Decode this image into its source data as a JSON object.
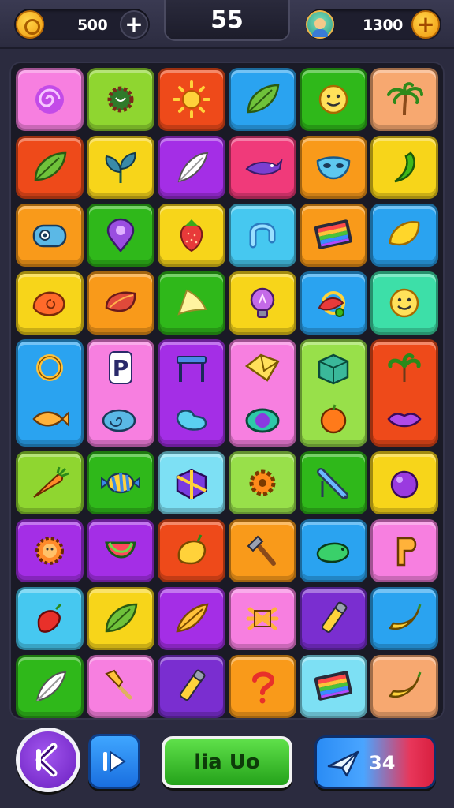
{
  "hud": {
    "coins": "500",
    "level": "55",
    "gems": "1300"
  },
  "colors": {
    "pink": "#f77fe0",
    "lime": "#8fd630",
    "red": "#ee4a1a",
    "blue": "#2aa3f0",
    "green": "#2fb81a",
    "peach": "#f7a870",
    "orange": "#f99a1a",
    "yellow": "#f7d51a",
    "purple": "#a42ee6",
    "magenta": "#f03a7a",
    "cyan": "#46c8f0",
    "aqua": "#3ddfa8",
    "ltlime": "#98e04a",
    "ltblue": "#7de0f4",
    "violet": "#7a2ed0"
  },
  "board": {
    "rows": [
      [
        {
          "color": "pink",
          "icons": [
            "swirl-icon"
          ]
        },
        {
          "color": "lime",
          "icons": [
            "spiky-creature-icon"
          ]
        },
        {
          "color": "red",
          "icons": [
            "sun-icon"
          ]
        },
        {
          "color": "blue",
          "icons": [
            "leaf-icon"
          ]
        },
        {
          "color": "green",
          "icons": [
            "smiley-icon"
          ]
        },
        {
          "color": "peach",
          "icons": [
            "palm-tree-icon"
          ]
        }
      ],
      [
        {
          "color": "red",
          "icons": [
            "leaf-icon"
          ]
        },
        {
          "color": "yellow",
          "icons": [
            "plant-icon"
          ]
        },
        {
          "color": "purple",
          "icons": [
            "feather-icon"
          ]
        },
        {
          "color": "magenta",
          "icons": [
            "bird-icon"
          ]
        },
        {
          "color": "orange",
          "icons": [
            "mask-icon"
          ]
        },
        {
          "color": "yellow",
          "icons": [
            "chili-icon"
          ]
        }
      ],
      [
        {
          "color": "orange",
          "icons": [
            "camera-creature-icon"
          ]
        },
        {
          "color": "green",
          "icons": [
            "pin-icon"
          ]
        },
        {
          "color": "yellow",
          "icons": [
            "strawberry-icon"
          ]
        },
        {
          "color": "cyan",
          "icons": [
            "hook-icon"
          ]
        },
        {
          "color": "orange",
          "icons": [
            "rainbow-book-icon"
          ]
        },
        {
          "color": "blue",
          "icons": [
            "lemon-icon"
          ]
        }
      ],
      [
        {
          "color": "yellow",
          "icons": [
            "shell-icon"
          ]
        },
        {
          "color": "orange",
          "icons": [
            "chestnut-icon"
          ]
        },
        {
          "color": "green",
          "icons": [
            "cheese-icon"
          ]
        },
        {
          "color": "yellow",
          "icons": [
            "lightbulb-icon"
          ]
        },
        {
          "color": "blue",
          "icons": [
            "flower-icon"
          ]
        },
        {
          "color": "aqua",
          "icons": [
            "smiley-icon"
          ]
        }
      ],
      [
        {
          "color": "blue",
          "icons": [
            "ring-icon",
            "fish-icon"
          ]
        },
        {
          "color": "pink",
          "letter": "P",
          "icons": [
            "letter-tile-icon",
            "snail-icon"
          ]
        },
        {
          "color": "purple",
          "icons": [
            "table-icon",
            "bean-icon"
          ]
        },
        {
          "color": "pink",
          "icons": [
            "envelope-icon",
            "potion-icon"
          ]
        },
        {
          "color": "ltlime",
          "icons": [
            "cube-icon",
            "orange-fruit-icon"
          ]
        },
        {
          "color": "red",
          "icons": [
            "palm-leaf-icon",
            "lips-icon"
          ]
        }
      ],
      [
        {
          "color": "lime",
          "icons": [
            "carrot-icon"
          ]
        },
        {
          "color": "green",
          "icons": [
            "candy-icon"
          ]
        },
        {
          "color": "ltblue",
          "icons": [
            "gift-box-icon"
          ]
        },
        {
          "color": "ltlime",
          "icons": [
            "gear-icon"
          ]
        },
        {
          "color": "green",
          "icons": [
            "brush-icon"
          ]
        },
        {
          "color": "yellow",
          "icons": [
            "plum-icon"
          ]
        }
      ],
      [
        {
          "color": "purple",
          "icons": [
            "lion-icon"
          ]
        },
        {
          "color": "purple",
          "icons": [
            "watermelon-icon"
          ]
        },
        {
          "color": "red",
          "icons": [
            "mango-icon"
          ]
        },
        {
          "color": "orange",
          "icons": [
            "hammer-icon"
          ]
        },
        {
          "color": "blue",
          "icons": [
            "turtle-icon"
          ]
        },
        {
          "color": "pink",
          "icons": [
            "key-letter-icon"
          ]
        }
      ],
      [
        {
          "color": "cyan",
          "icons": [
            "chili-pepper-icon"
          ]
        },
        {
          "color": "yellow",
          "icons": [
            "leaf-icon"
          ]
        },
        {
          "color": "purple",
          "icons": [
            "banana-leaf-icon"
          ]
        },
        {
          "color": "pink",
          "icons": [
            "pinwheel-icon"
          ]
        },
        {
          "color": "violet",
          "icons": [
            "marker-icon"
          ]
        },
        {
          "color": "blue",
          "icons": [
            "banana-icon"
          ]
        }
      ],
      [
        {
          "color": "green",
          "icons": [
            "feather-icon"
          ]
        },
        {
          "color": "pink",
          "icons": [
            "broom-icon"
          ]
        },
        {
          "color": "violet",
          "icons": [
            "marker-icon"
          ]
        },
        {
          "color": "orange",
          "icons": [
            "question-icon"
          ]
        },
        {
          "color": "ltblue",
          "icons": [
            "rainbow-book-icon"
          ]
        },
        {
          "color": "peach",
          "icons": [
            "banana-icon"
          ]
        }
      ]
    ]
  },
  "controls": {
    "back_icon": "back-arrow-icon",
    "play_icon": "skip-forward-icon",
    "green_label": "lia Uo",
    "hint_icon": "paper-plane-icon",
    "hint_count": "34"
  }
}
